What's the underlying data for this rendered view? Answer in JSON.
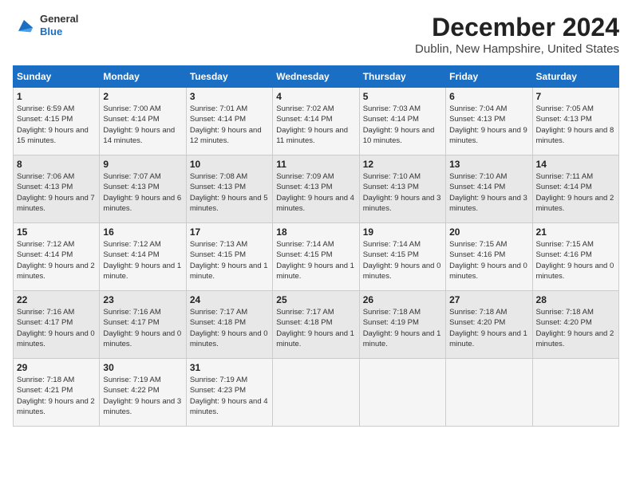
{
  "logo": {
    "general": "General",
    "blue": "Blue"
  },
  "header": {
    "title": "December 2024",
    "subtitle": "Dublin, New Hampshire, United States"
  },
  "calendar": {
    "days_of_week": [
      "Sunday",
      "Monday",
      "Tuesday",
      "Wednesday",
      "Thursday",
      "Friday",
      "Saturday"
    ],
    "weeks": [
      [
        {
          "day": "1",
          "sunrise": "Sunrise: 6:59 AM",
          "sunset": "Sunset: 4:15 PM",
          "daylight": "Daylight: 9 hours and 15 minutes."
        },
        {
          "day": "2",
          "sunrise": "Sunrise: 7:00 AM",
          "sunset": "Sunset: 4:14 PM",
          "daylight": "Daylight: 9 hours and 14 minutes."
        },
        {
          "day": "3",
          "sunrise": "Sunrise: 7:01 AM",
          "sunset": "Sunset: 4:14 PM",
          "daylight": "Daylight: 9 hours and 12 minutes."
        },
        {
          "day": "4",
          "sunrise": "Sunrise: 7:02 AM",
          "sunset": "Sunset: 4:14 PM",
          "daylight": "Daylight: 9 hours and 11 minutes."
        },
        {
          "day": "5",
          "sunrise": "Sunrise: 7:03 AM",
          "sunset": "Sunset: 4:14 PM",
          "daylight": "Daylight: 9 hours and 10 minutes."
        },
        {
          "day": "6",
          "sunrise": "Sunrise: 7:04 AM",
          "sunset": "Sunset: 4:13 PM",
          "daylight": "Daylight: 9 hours and 9 minutes."
        },
        {
          "day": "7",
          "sunrise": "Sunrise: 7:05 AM",
          "sunset": "Sunset: 4:13 PM",
          "daylight": "Daylight: 9 hours and 8 minutes."
        }
      ],
      [
        {
          "day": "8",
          "sunrise": "Sunrise: 7:06 AM",
          "sunset": "Sunset: 4:13 PM",
          "daylight": "Daylight: 9 hours and 7 minutes."
        },
        {
          "day": "9",
          "sunrise": "Sunrise: 7:07 AM",
          "sunset": "Sunset: 4:13 PM",
          "daylight": "Daylight: 9 hours and 6 minutes."
        },
        {
          "day": "10",
          "sunrise": "Sunrise: 7:08 AM",
          "sunset": "Sunset: 4:13 PM",
          "daylight": "Daylight: 9 hours and 5 minutes."
        },
        {
          "day": "11",
          "sunrise": "Sunrise: 7:09 AM",
          "sunset": "Sunset: 4:13 PM",
          "daylight": "Daylight: 9 hours and 4 minutes."
        },
        {
          "day": "12",
          "sunrise": "Sunrise: 7:10 AM",
          "sunset": "Sunset: 4:13 PM",
          "daylight": "Daylight: 9 hours and 3 minutes."
        },
        {
          "day": "13",
          "sunrise": "Sunrise: 7:10 AM",
          "sunset": "Sunset: 4:14 PM",
          "daylight": "Daylight: 9 hours and 3 minutes."
        },
        {
          "day": "14",
          "sunrise": "Sunrise: 7:11 AM",
          "sunset": "Sunset: 4:14 PM",
          "daylight": "Daylight: 9 hours and 2 minutes."
        }
      ],
      [
        {
          "day": "15",
          "sunrise": "Sunrise: 7:12 AM",
          "sunset": "Sunset: 4:14 PM",
          "daylight": "Daylight: 9 hours and 2 minutes."
        },
        {
          "day": "16",
          "sunrise": "Sunrise: 7:12 AM",
          "sunset": "Sunset: 4:14 PM",
          "daylight": "Daylight: 9 hours and 1 minute."
        },
        {
          "day": "17",
          "sunrise": "Sunrise: 7:13 AM",
          "sunset": "Sunset: 4:15 PM",
          "daylight": "Daylight: 9 hours and 1 minute."
        },
        {
          "day": "18",
          "sunrise": "Sunrise: 7:14 AM",
          "sunset": "Sunset: 4:15 PM",
          "daylight": "Daylight: 9 hours and 1 minute."
        },
        {
          "day": "19",
          "sunrise": "Sunrise: 7:14 AM",
          "sunset": "Sunset: 4:15 PM",
          "daylight": "Daylight: 9 hours and 0 minutes."
        },
        {
          "day": "20",
          "sunrise": "Sunrise: 7:15 AM",
          "sunset": "Sunset: 4:16 PM",
          "daylight": "Daylight: 9 hours and 0 minutes."
        },
        {
          "day": "21",
          "sunrise": "Sunrise: 7:15 AM",
          "sunset": "Sunset: 4:16 PM",
          "daylight": "Daylight: 9 hours and 0 minutes."
        }
      ],
      [
        {
          "day": "22",
          "sunrise": "Sunrise: 7:16 AM",
          "sunset": "Sunset: 4:17 PM",
          "daylight": "Daylight: 9 hours and 0 minutes."
        },
        {
          "day": "23",
          "sunrise": "Sunrise: 7:16 AM",
          "sunset": "Sunset: 4:17 PM",
          "daylight": "Daylight: 9 hours and 0 minutes."
        },
        {
          "day": "24",
          "sunrise": "Sunrise: 7:17 AM",
          "sunset": "Sunset: 4:18 PM",
          "daylight": "Daylight: 9 hours and 0 minutes."
        },
        {
          "day": "25",
          "sunrise": "Sunrise: 7:17 AM",
          "sunset": "Sunset: 4:18 PM",
          "daylight": "Daylight: 9 hours and 1 minute."
        },
        {
          "day": "26",
          "sunrise": "Sunrise: 7:18 AM",
          "sunset": "Sunset: 4:19 PM",
          "daylight": "Daylight: 9 hours and 1 minute."
        },
        {
          "day": "27",
          "sunrise": "Sunrise: 7:18 AM",
          "sunset": "Sunset: 4:20 PM",
          "daylight": "Daylight: 9 hours and 1 minute."
        },
        {
          "day": "28",
          "sunrise": "Sunrise: 7:18 AM",
          "sunset": "Sunset: 4:20 PM",
          "daylight": "Daylight: 9 hours and 2 minutes."
        }
      ],
      [
        {
          "day": "29",
          "sunrise": "Sunrise: 7:18 AM",
          "sunset": "Sunset: 4:21 PM",
          "daylight": "Daylight: 9 hours and 2 minutes."
        },
        {
          "day": "30",
          "sunrise": "Sunrise: 7:19 AM",
          "sunset": "Sunset: 4:22 PM",
          "daylight": "Daylight: 9 hours and 3 minutes."
        },
        {
          "day": "31",
          "sunrise": "Sunrise: 7:19 AM",
          "sunset": "Sunset: 4:23 PM",
          "daylight": "Daylight: 9 hours and 4 minutes."
        },
        null,
        null,
        null,
        null
      ]
    ]
  }
}
